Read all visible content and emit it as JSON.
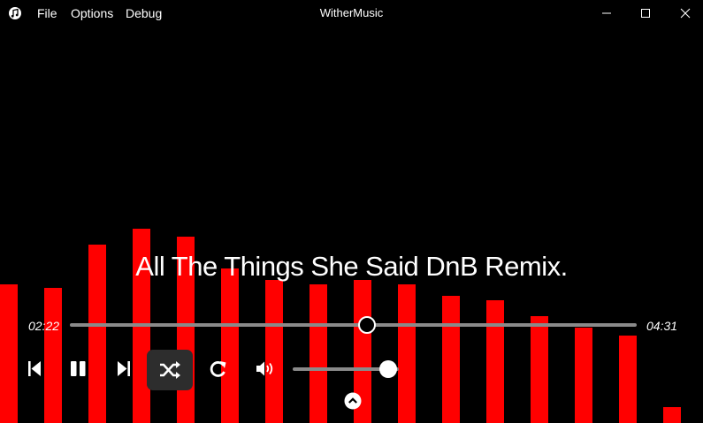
{
  "window": {
    "title": "WitherMusic",
    "menu": [
      "File",
      "Options",
      "Debug"
    ]
  },
  "icons": {
    "app": "music-note-icon",
    "minimize": "minimize-icon",
    "maximize": "maximize-icon",
    "close": "close-icon",
    "prev": "skip-previous-icon",
    "pause": "pause-icon",
    "next": "skip-next-icon",
    "shuffle": "shuffle-icon",
    "repeat": "repeat-icon",
    "volume": "volume-icon",
    "expand": "chevron-up-icon"
  },
  "colors": {
    "background": "#000000",
    "visualizer_bar": "#ff0000",
    "track": "#8a8a8a",
    "shuffle_active_bg": "#2d2d2d"
  },
  "song": {
    "title": "All The Things She Said DnB Remix."
  },
  "playback": {
    "current_time": "02:22",
    "total_time": "04:31",
    "progress": 0.524,
    "volume": 0.9,
    "shuffle_active": true
  },
  "visualizer": {
    "levels": [
      0.35,
      0.34,
      0.45,
      0.49,
      0.47,
      0.39,
      0.36,
      0.35,
      0.36,
      0.35,
      0.32,
      0.31,
      0.27,
      0.24,
      0.22,
      0.04
    ]
  }
}
